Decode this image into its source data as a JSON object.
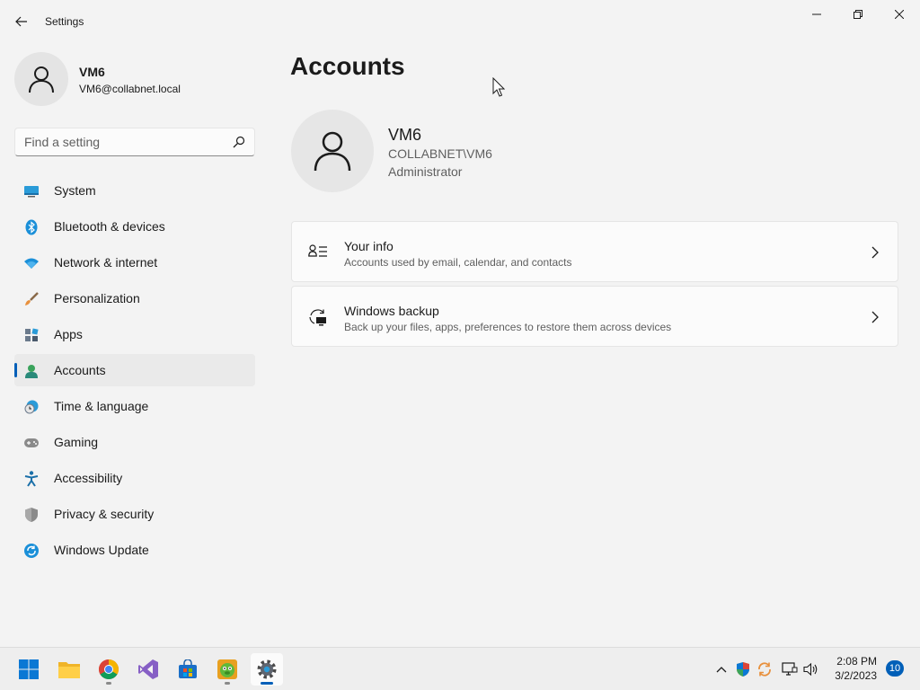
{
  "window": {
    "title": "Settings"
  },
  "user": {
    "name": "VM6",
    "email": "VM6@collabnet.local"
  },
  "search": {
    "placeholder": "Find a setting"
  },
  "nav": {
    "items": [
      {
        "label": "System",
        "icon": "monitor-icon"
      },
      {
        "label": "Bluetooth & devices",
        "icon": "bluetooth-icon"
      },
      {
        "label": "Network & internet",
        "icon": "wifi-icon"
      },
      {
        "label": "Personalization",
        "icon": "brush-icon"
      },
      {
        "label": "Apps",
        "icon": "apps-icon"
      },
      {
        "label": "Accounts",
        "icon": "person-icon",
        "active": true
      },
      {
        "label": "Time & language",
        "icon": "clock-globe-icon"
      },
      {
        "label": "Gaming",
        "icon": "gamepad-icon"
      },
      {
        "label": "Accessibility",
        "icon": "accessibility-icon"
      },
      {
        "label": "Privacy & security",
        "icon": "shield-icon"
      },
      {
        "label": "Windows Update",
        "icon": "update-icon"
      }
    ]
  },
  "main": {
    "title": "Accounts",
    "account": {
      "name": "VM6",
      "domain": "COLLABNET\\VM6",
      "role": "Administrator"
    },
    "cards": [
      {
        "title": "Your info",
        "description": "Accounts used by email, calendar, and contacts",
        "icon": "contact-info-icon"
      },
      {
        "title": "Windows backup",
        "description": "Back up your files, apps, preferences to restore them across devices",
        "icon": "backup-icon"
      }
    ]
  },
  "taskbar": {
    "apps": [
      "start-icon",
      "file-explorer-icon",
      "chrome-icon",
      "visual-studio-icon",
      "store-icon",
      "game-app-icon",
      "settings-icon"
    ],
    "clock": {
      "time": "2:08 PM",
      "date": "3/2/2023"
    },
    "notifications": "10"
  },
  "colors": {
    "accent": "#005fb8",
    "background": "#f3f3f3",
    "card": "#fbfbfb"
  }
}
